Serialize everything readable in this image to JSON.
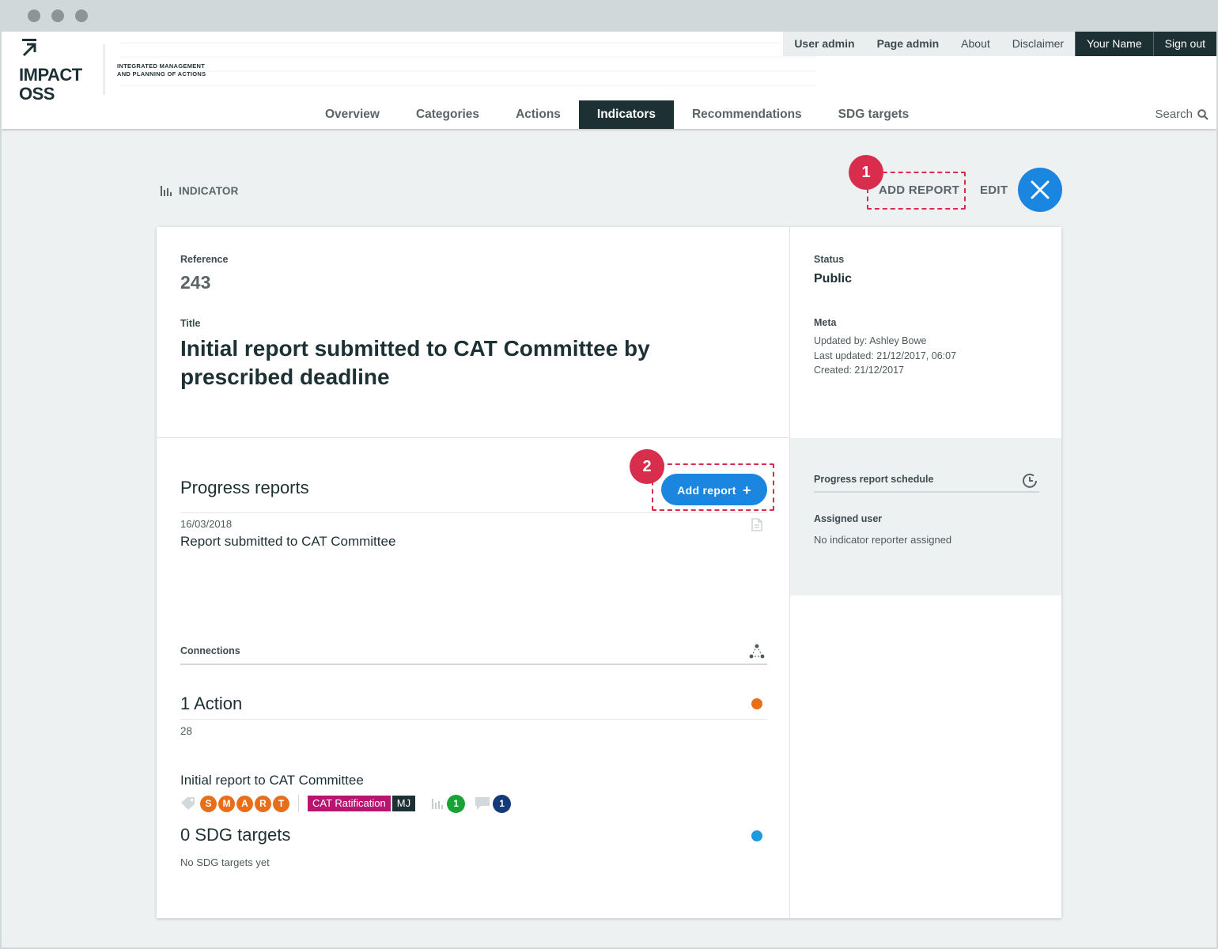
{
  "topnav": {
    "user_admin": "User admin",
    "page_admin": "Page admin",
    "about": "About",
    "disclaimer": "Disclaimer",
    "user_name": "Your Name",
    "sign_out": "Sign out"
  },
  "brand": {
    "line1": "IMPACT",
    "line2": "OSS",
    "claim_line1": "INTEGRATED MANAGEMENT",
    "claim_line2": "AND PLANNING OF ACTIONS"
  },
  "mainnav": {
    "tabs": [
      {
        "label": "Overview"
      },
      {
        "label": "Categories"
      },
      {
        "label": "Actions"
      },
      {
        "label": "Indicators",
        "active": true
      },
      {
        "label": "Recommendations"
      },
      {
        "label": "SDG targets"
      }
    ],
    "search_label": "Search"
  },
  "page": {
    "kind_label": "INDICATOR",
    "add_report_label": "ADD REPORT",
    "edit_label": "EDIT",
    "annotation_1": "1",
    "annotation_2": "2"
  },
  "main": {
    "reference_label": "Reference",
    "reference_value": "243",
    "title_label": "Title",
    "title_value": "Initial report submitted to CAT Committee by prescribed deadline"
  },
  "side": {
    "status_label": "Status",
    "status_value": "Public",
    "meta_label": "Meta",
    "updated_by": "Updated by: Ashley Bowe",
    "last_updated": "Last updated: 21/12/2017, 06:07",
    "created": "Created: 21/12/2017",
    "schedule_label": "Progress report schedule",
    "assigned_label": "Assigned user",
    "assigned_value": "No indicator reporter assigned"
  },
  "progress": {
    "heading": "Progress reports",
    "add_button": "Add report",
    "reports": [
      {
        "date": "16/03/2018",
        "title": "Report submitted to CAT Committee"
      }
    ]
  },
  "connections": {
    "label": "Connections",
    "actions_heading": "1 Action",
    "actions_color": "#e96e1a",
    "action": {
      "ref": "28",
      "title": "Initial report to CAT Committee",
      "smart": [
        "S",
        "M",
        "A",
        "R",
        "T"
      ],
      "category": "CAT Ratification",
      "category_color": "#b7156f",
      "owner": "MJ",
      "owner_color": "#1d3033",
      "indicator_count": "1",
      "indicator_color": "#17a336",
      "comment_count": "1",
      "comment_color": "#153a7a"
    },
    "sdg_heading": "0 SDG targets",
    "sdg_color": "#1e9be0",
    "sdg_empty": "No SDG targets yet"
  },
  "colors": {
    "accent_blue": "#1b86e0",
    "annotation_red": "#d92d4e",
    "smart_orange": "#e96e1a",
    "nav_dark": "#1d3033"
  }
}
